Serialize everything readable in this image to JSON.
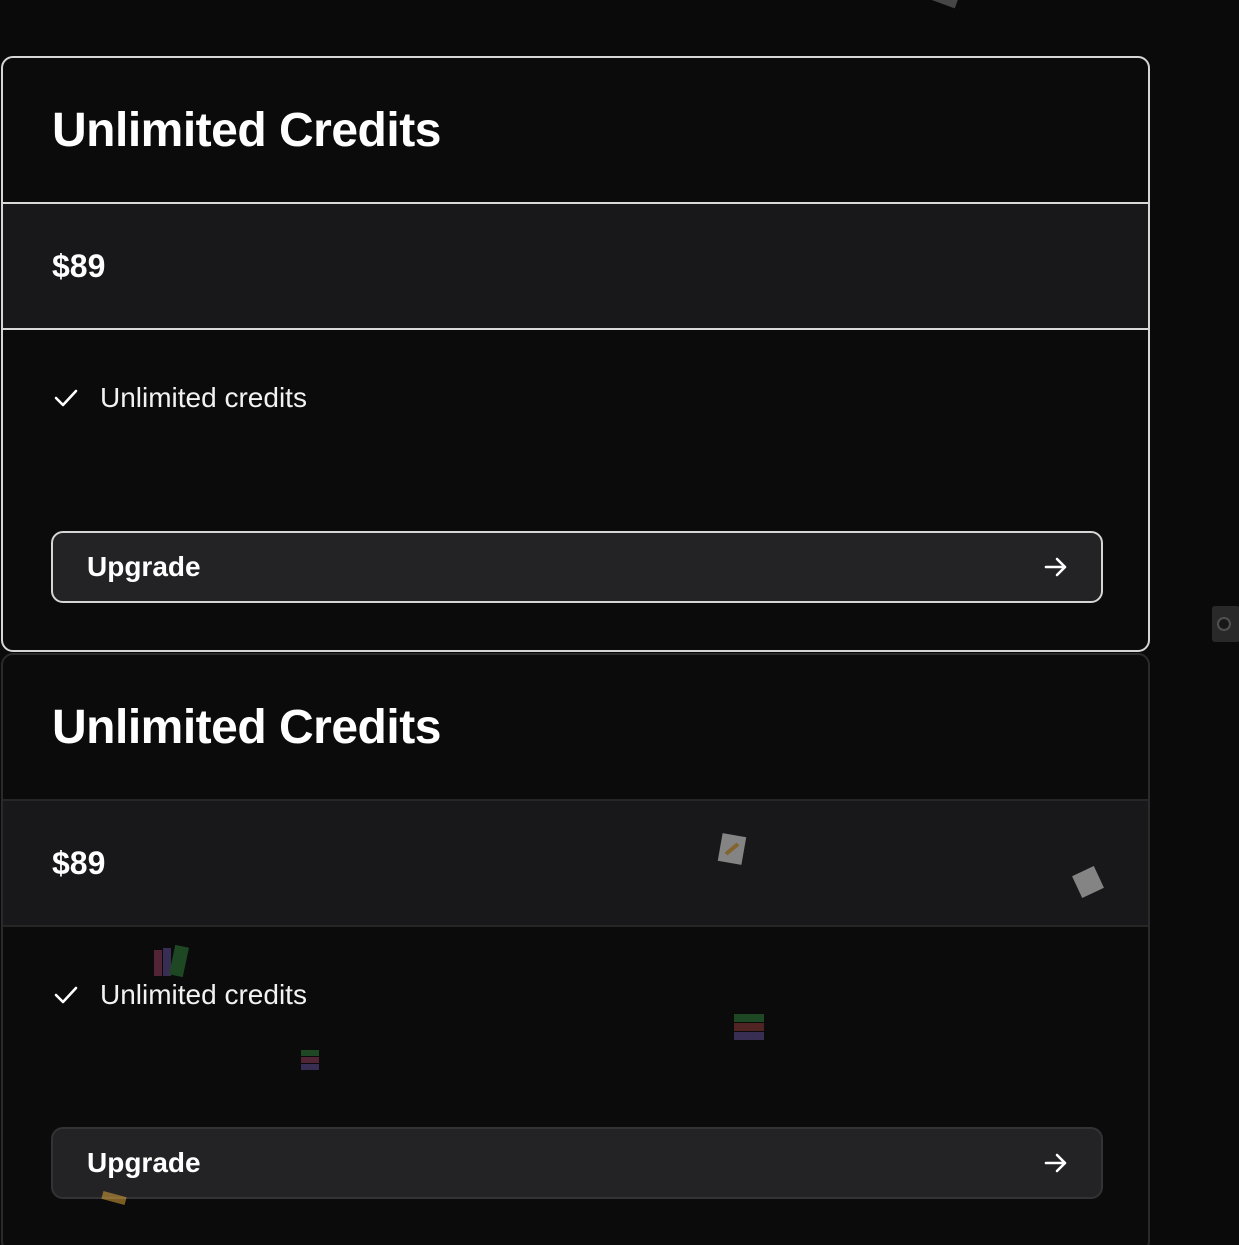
{
  "cards": [
    {
      "title": "Unlimited Credits",
      "price": "$89",
      "features": [
        "Unlimited credits"
      ],
      "button_label": "Upgrade",
      "state": "selected"
    },
    {
      "title": "Unlimited Credits",
      "price": "$89",
      "features": [
        "Unlimited credits"
      ],
      "button_label": "Upgrade",
      "state": "default"
    }
  ],
  "icons": {
    "check": "check-icon",
    "arrow": "arrow-right-icon"
  },
  "colors": {
    "background": "#0a0a0a",
    "price_band": "#18181a",
    "button": "#232325",
    "selected_border": "#d9d9d9",
    "default_border": "#2a2a2a",
    "text": "#ffffff"
  }
}
